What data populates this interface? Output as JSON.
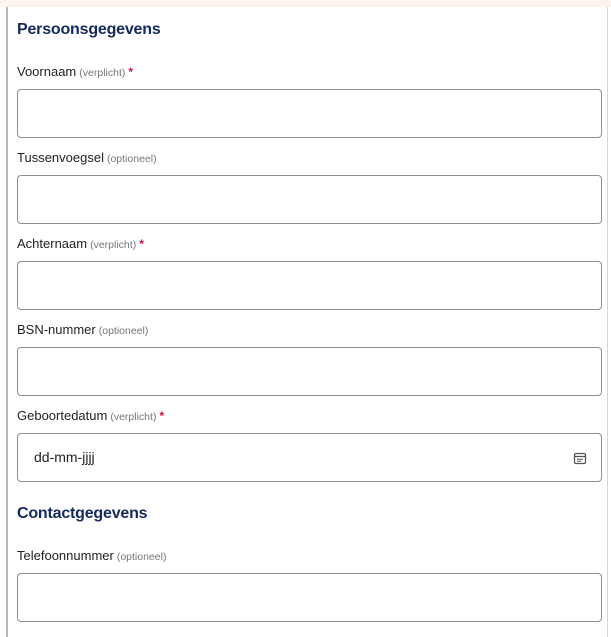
{
  "sections": {
    "personal": {
      "title": "Persoonsgegevens"
    },
    "contact": {
      "title": "Contactgegevens"
    }
  },
  "fields": {
    "voornaam": {
      "label": "Voornaam",
      "hint": "(verplicht)",
      "required_mark": "*",
      "value": ""
    },
    "tussenvoegsel": {
      "label": "Tussenvoegsel",
      "hint": "(optioneel)",
      "value": ""
    },
    "achternaam": {
      "label": "Achternaam",
      "hint": "(verplicht)",
      "required_mark": "*",
      "value": ""
    },
    "bsn": {
      "label": "BSN-nummer",
      "hint": "(optioneel)",
      "value": ""
    },
    "geboortedatum": {
      "label": "Geboortedatum",
      "hint": "(verplicht)",
      "required_mark": "*",
      "display": "dd-mm-jjjj",
      "icon": "calendar-icon"
    },
    "telefoonnummer": {
      "label": "Telefoonnummer",
      "hint": "(optioneel)",
      "value": ""
    }
  },
  "colors": {
    "heading": "#152a5c",
    "required": "#c4153a",
    "hint": "#767676",
    "border": "#8e8e8e",
    "top_band": "#fdf3ea"
  }
}
